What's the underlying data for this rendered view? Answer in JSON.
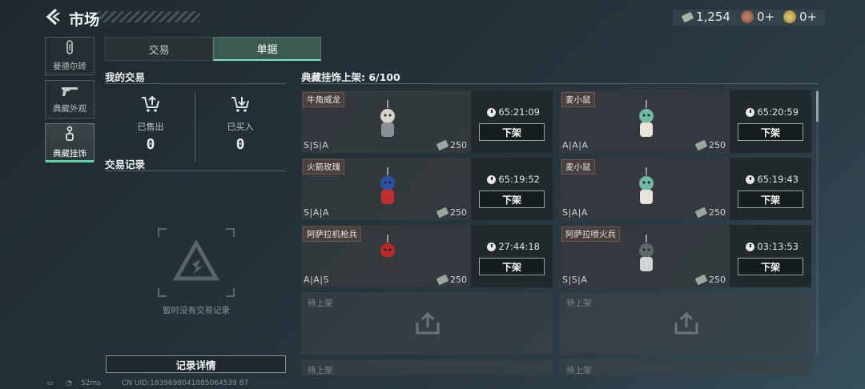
{
  "header": {
    "title": "市场",
    "currencies": [
      {
        "icon": "cash-icon",
        "value": "1,254"
      },
      {
        "icon": "bronze-coin-icon",
        "value": "0+"
      },
      {
        "icon": "gold-coin-icon",
        "value": "0+"
      }
    ]
  },
  "sidebar": {
    "items": [
      {
        "label": "曼德尔砖",
        "icon": "brick-icon"
      },
      {
        "label": "典藏外观",
        "icon": "gun-icon"
      },
      {
        "label": "典藏挂饰",
        "icon": "charm-icon",
        "active": true
      }
    ]
  },
  "tabs": [
    {
      "label": "交易"
    },
    {
      "label": "单据",
      "active": true
    }
  ],
  "my_trade": {
    "title": "我的交易",
    "sold": {
      "label": "已售出",
      "value": "0"
    },
    "bought": {
      "label": "已买入",
      "value": "0"
    }
  },
  "history": {
    "title": "交易记录",
    "empty_text": "暂时没有交易记录",
    "detail_button": "记录详情"
  },
  "listing": {
    "title": "典藏挂饰上架: 6/100",
    "delist_label": "下架",
    "empty_slot_label": "待上架",
    "items": [
      {
        "name": "牛角威龙",
        "grade": "S|S|A",
        "price": "250",
        "timer": "65:21:09"
      },
      {
        "name": "麦小鼠",
        "grade": "A|A|A",
        "price": "250",
        "timer": "65:20:59"
      },
      {
        "name": "火箭玫瑰",
        "grade": "S|A|A",
        "price": "250",
        "timer": "65:19:52"
      },
      {
        "name": "麦小鼠",
        "grade": "S|A|A",
        "price": "250",
        "timer": "65:19:43"
      },
      {
        "name": "阿萨拉机枪兵",
        "grade": "A|A|S",
        "price": "250",
        "timer": "27:44:18"
      },
      {
        "name": "阿萨拉喷火兵",
        "grade": "S|S|A",
        "price": "250",
        "timer": "03:13:53"
      }
    ]
  },
  "footer": {
    "ping": "52ms",
    "uid": "CN UID:1839698041885064539 87"
  },
  "colors": {
    "accent": "#5fd3a8",
    "tab_active_bg": "#3b5a50",
    "name_tag_bg": "#4a3f3a"
  }
}
